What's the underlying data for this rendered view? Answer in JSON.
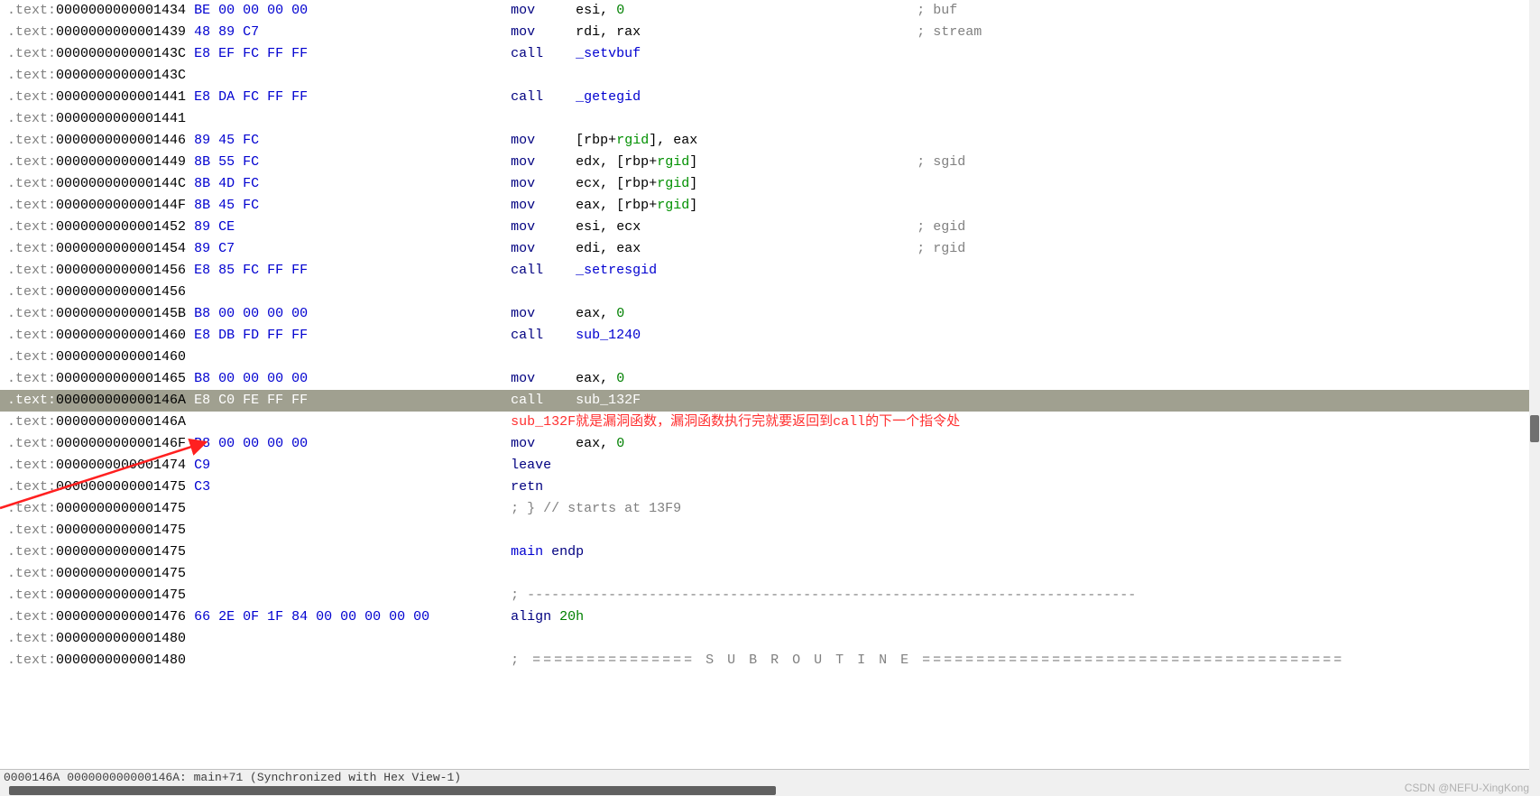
{
  "lines": [
    {
      "seg": ".text:",
      "addr": "0000000000001434",
      "bytes": "BE 00 00 00 00",
      "parts": [
        {
          "t": "mnemonic",
          "v": "mov     "
        },
        {
          "t": "reg",
          "v": "esi"
        },
        {
          "t": "opd",
          "v": ", "
        },
        {
          "t": "num",
          "v": "0"
        }
      ],
      "comment": "; buf"
    },
    {
      "seg": ".text:",
      "addr": "0000000000001439",
      "bytes": "48 89 C7",
      "parts": [
        {
          "t": "mnemonic",
          "v": "mov     "
        },
        {
          "t": "reg",
          "v": "rdi"
        },
        {
          "t": "opd",
          "v": ", "
        },
        {
          "t": "reg",
          "v": "rax"
        }
      ],
      "comment": "; stream"
    },
    {
      "seg": ".text:",
      "addr": "000000000000143C",
      "bytes": "E8 EF FC FF FF",
      "parts": [
        {
          "t": "mnemonic",
          "v": "call    "
        },
        {
          "t": "func",
          "v": "_setvbuf"
        }
      ]
    },
    {
      "seg": ".text:",
      "addr": "000000000000143C",
      "bytes": "",
      "parts": []
    },
    {
      "seg": ".text:",
      "addr": "0000000000001441",
      "bytes": "E8 DA FC FF FF",
      "parts": [
        {
          "t": "mnemonic",
          "v": "call    "
        },
        {
          "t": "func",
          "v": "_getegid"
        }
      ]
    },
    {
      "seg": ".text:",
      "addr": "0000000000001441",
      "bytes": "",
      "parts": []
    },
    {
      "seg": ".text:",
      "addr": "0000000000001446",
      "bytes": "89 45 FC",
      "parts": [
        {
          "t": "mnemonic",
          "v": "mov     "
        },
        {
          "t": "opd",
          "v": "["
        },
        {
          "t": "reg",
          "v": "rbp"
        },
        {
          "t": "opd",
          "v": "+"
        },
        {
          "t": "rgid",
          "v": "rgid"
        },
        {
          "t": "opd",
          "v": "], "
        },
        {
          "t": "reg",
          "v": "eax"
        }
      ]
    },
    {
      "seg": ".text:",
      "addr": "0000000000001449",
      "bytes": "8B 55 FC",
      "parts": [
        {
          "t": "mnemonic",
          "v": "mov     "
        },
        {
          "t": "reg",
          "v": "edx"
        },
        {
          "t": "opd",
          "v": ", ["
        },
        {
          "t": "reg",
          "v": "rbp"
        },
        {
          "t": "opd",
          "v": "+"
        },
        {
          "t": "rgid",
          "v": "rgid"
        },
        {
          "t": "opd",
          "v": "]"
        }
      ],
      "comment": "; sgid"
    },
    {
      "seg": ".text:",
      "addr": "000000000000144C",
      "bytes": "8B 4D FC",
      "parts": [
        {
          "t": "mnemonic",
          "v": "mov     "
        },
        {
          "t": "reg",
          "v": "ecx"
        },
        {
          "t": "opd",
          "v": ", ["
        },
        {
          "t": "reg",
          "v": "rbp"
        },
        {
          "t": "opd",
          "v": "+"
        },
        {
          "t": "rgid",
          "v": "rgid"
        },
        {
          "t": "opd",
          "v": "]"
        }
      ]
    },
    {
      "seg": ".text:",
      "addr": "000000000000144F",
      "bytes": "8B 45 FC",
      "parts": [
        {
          "t": "mnemonic",
          "v": "mov     "
        },
        {
          "t": "reg",
          "v": "eax"
        },
        {
          "t": "opd",
          "v": ", ["
        },
        {
          "t": "reg",
          "v": "rbp"
        },
        {
          "t": "opd",
          "v": "+"
        },
        {
          "t": "rgid",
          "v": "rgid"
        },
        {
          "t": "opd",
          "v": "]"
        }
      ]
    },
    {
      "seg": ".text:",
      "addr": "0000000000001452",
      "bytes": "89 CE",
      "parts": [
        {
          "t": "mnemonic",
          "v": "mov     "
        },
        {
          "t": "reg",
          "v": "esi"
        },
        {
          "t": "opd",
          "v": ", "
        },
        {
          "t": "reg",
          "v": "ecx"
        }
      ],
      "comment": "; egid"
    },
    {
      "seg": ".text:",
      "addr": "0000000000001454",
      "bytes": "89 C7",
      "parts": [
        {
          "t": "mnemonic",
          "v": "mov     "
        },
        {
          "t": "reg",
          "v": "edi"
        },
        {
          "t": "opd",
          "v": ", "
        },
        {
          "t": "reg",
          "v": "eax"
        }
      ],
      "comment": "; rgid"
    },
    {
      "seg": ".text:",
      "addr": "0000000000001456",
      "bytes": "E8 85 FC FF FF",
      "parts": [
        {
          "t": "mnemonic",
          "v": "call    "
        },
        {
          "t": "func",
          "v": "_setresgid"
        }
      ]
    },
    {
      "seg": ".text:",
      "addr": "0000000000001456",
      "bytes": "",
      "parts": []
    },
    {
      "seg": ".text:",
      "addr": "000000000000145B",
      "bytes": "B8 00 00 00 00",
      "parts": [
        {
          "t": "mnemonic",
          "v": "mov     "
        },
        {
          "t": "reg",
          "v": "eax"
        },
        {
          "t": "opd",
          "v": ", "
        },
        {
          "t": "num",
          "v": "0"
        }
      ]
    },
    {
      "seg": ".text:",
      "addr": "0000000000001460",
      "bytes": "E8 DB FD FF FF",
      "parts": [
        {
          "t": "mnemonic",
          "v": "call    "
        },
        {
          "t": "func",
          "v": "sub_1240"
        }
      ]
    },
    {
      "seg": ".text:",
      "addr": "0000000000001460",
      "bytes": "",
      "parts": []
    },
    {
      "seg": ".text:",
      "addr": "0000000000001465",
      "bytes": "B8 00 00 00 00",
      "parts": [
        {
          "t": "mnemonic",
          "v": "mov     "
        },
        {
          "t": "reg",
          "v": "eax"
        },
        {
          "t": "opd",
          "v": ", "
        },
        {
          "t": "num",
          "v": "0"
        }
      ]
    },
    {
      "seg": ".text:",
      "addr": "000000000000146A",
      "bytes": "E8 C0 FE FF FF",
      "parts": [
        {
          "t": "mnemonic",
          "v": "call    "
        },
        {
          "t": "func",
          "v": "sub_132F"
        }
      ],
      "highlighted": true
    },
    {
      "seg": ".text:",
      "addr": "000000000000146A",
      "bytes": "",
      "parts": [],
      "annotation": "sub_132F就是漏洞函数，漏洞函数执行完就要返回到call的下一个指令处"
    },
    {
      "seg": ".text:",
      "addr": "000000000000146F",
      "bytes": "B8 00 00 00 00",
      "parts": [
        {
          "t": "mnemonic",
          "v": "mov     "
        },
        {
          "t": "reg",
          "v": "eax"
        },
        {
          "t": "opd",
          "v": ", "
        },
        {
          "t": "num",
          "v": "0"
        }
      ]
    },
    {
      "seg": ".text:",
      "addr": "0000000000001474",
      "bytes": "C9",
      "parts": [
        {
          "t": "mnemonic",
          "v": "leave"
        }
      ]
    },
    {
      "seg": ".text:",
      "addr": "0000000000001475",
      "bytes": "C3",
      "parts": [
        {
          "t": "mnemonic",
          "v": "retn"
        }
      ]
    },
    {
      "seg": ".text:",
      "addr": "0000000000001475",
      "bytes": "",
      "parts": [
        {
          "t": "comment-text",
          "v": "; } // starts at 13F9"
        }
      ]
    },
    {
      "seg": ".text:",
      "addr": "0000000000001475",
      "bytes": "",
      "parts": []
    },
    {
      "seg": ".text:",
      "addr": "0000000000001475",
      "bytes": "",
      "parts": [
        {
          "t": "func",
          "v": "main "
        },
        {
          "t": "mnemonic",
          "v": "endp"
        }
      ]
    },
    {
      "seg": ".text:",
      "addr": "0000000000001475",
      "bytes": "",
      "parts": []
    },
    {
      "seg": ".text:",
      "addr": "0000000000001475",
      "bytes": "",
      "parts": [
        {
          "t": "dashline",
          "v": "; ---------------------------------------------------------------------------"
        }
      ]
    },
    {
      "seg": ".text:",
      "addr": "0000000000001476",
      "bytes": "66 2E 0F 1F 84 00 00 00 00 00",
      "parts": [
        {
          "t": "mnemonic",
          "v": "align "
        },
        {
          "t": "num",
          "v": "20h"
        }
      ]
    },
    {
      "seg": ".text:",
      "addr": "0000000000001480",
      "bytes": "",
      "parts": []
    },
    {
      "seg": ".text:",
      "addr": "0000000000001480",
      "bytes": "",
      "parts": [
        {
          "t": "subroutine",
          "v": "; =============== S U B R O U T I N E ======================================="
        }
      ]
    }
  ],
  "bytesColStart": 27,
  "mnemonicColStart": 62,
  "commentColStart": 112,
  "statusBar": "0000146A 000000000000146A: main+71 (Synchronized with Hex View-1)",
  "watermark": "CSDN @NEFU-XingKong"
}
